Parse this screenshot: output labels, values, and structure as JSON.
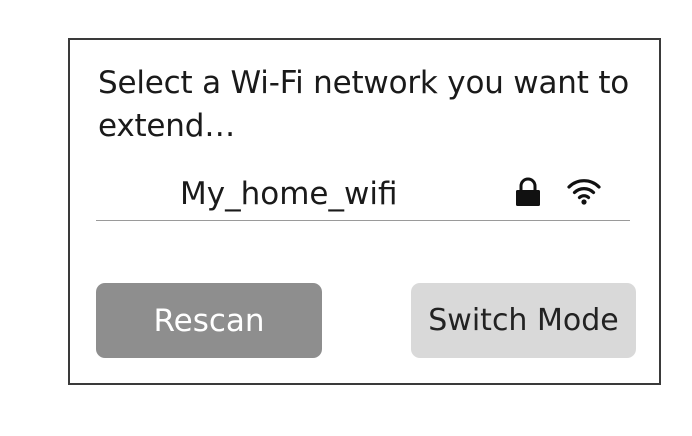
{
  "dialog": {
    "prompt": "Select a Wi-Fi network you want to extend…"
  },
  "network": {
    "ssid": "My_home_wifi",
    "secured_icon": "lock-icon",
    "signal_icon": "wifi-icon"
  },
  "buttons": {
    "rescan_label": "Rescan",
    "switch_mode_label": "Switch Mode"
  },
  "colors": {
    "rescan_bg": "#8e8e8e",
    "switch_mode_bg": "#d9d9d9",
    "border": "#3a3a3a"
  }
}
